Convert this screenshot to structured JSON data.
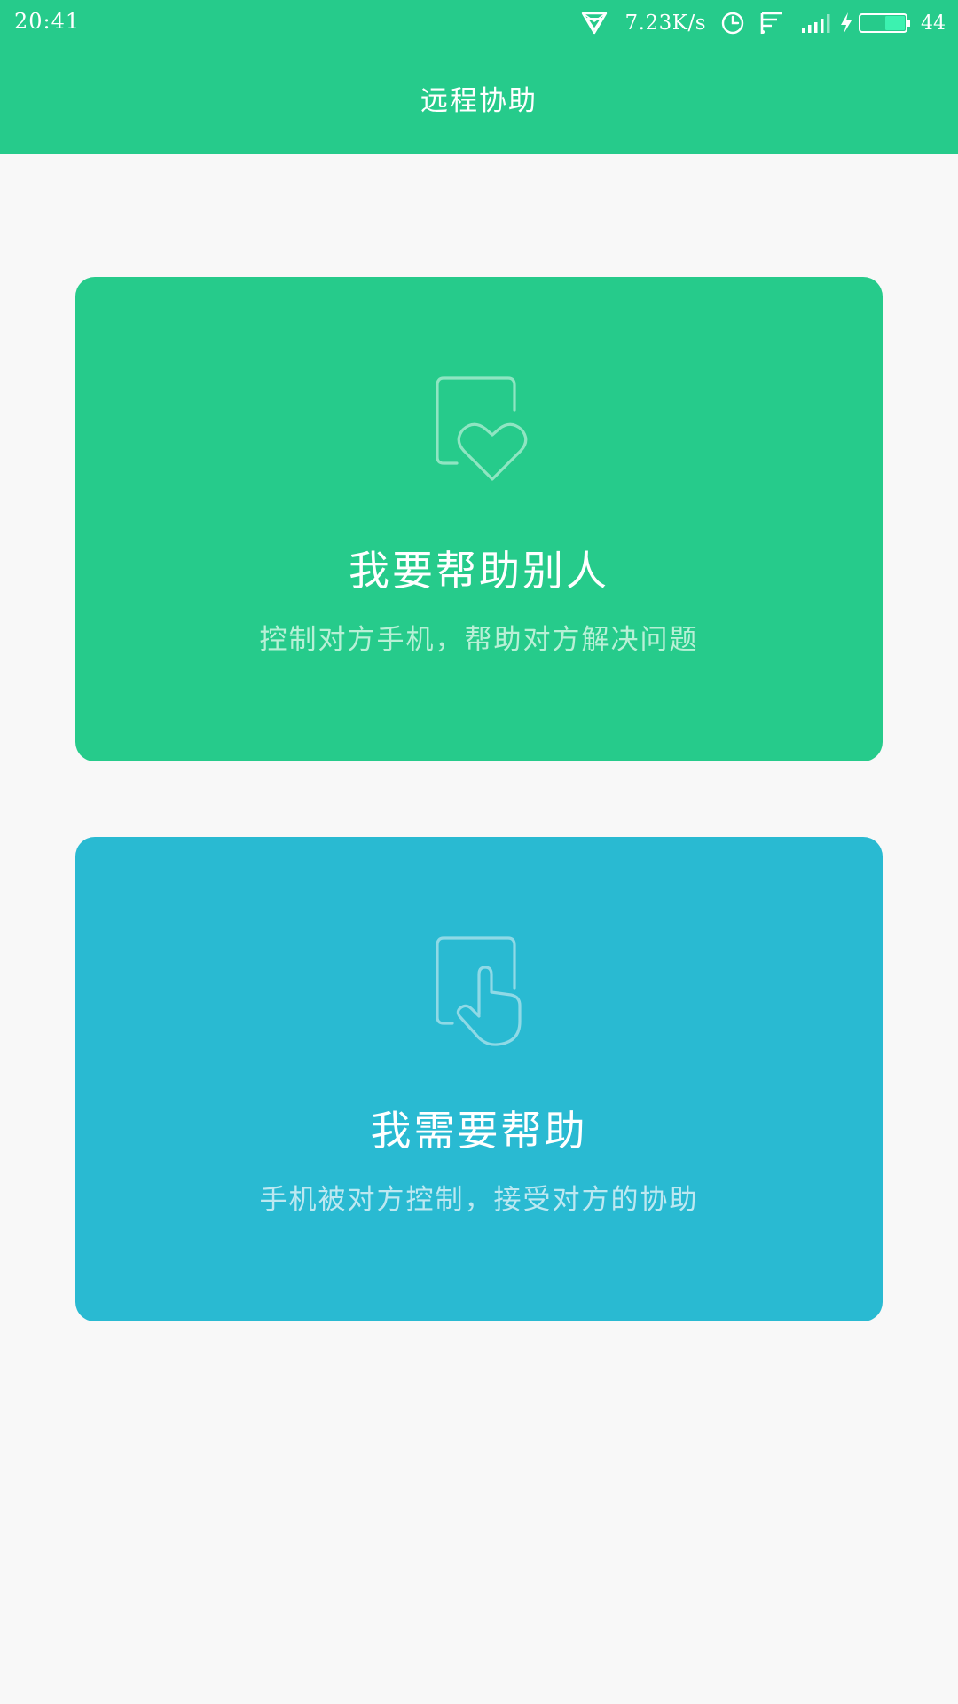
{
  "status_bar": {
    "time": "20:41",
    "network_speed": "7.23K/s",
    "battery_percent": "44",
    "battery_level": 0.44,
    "icons": [
      "vpn-triangle-icon",
      "alarm-clock-icon",
      "cast-icon",
      "signal-icon",
      "charging-icon",
      "battery-icon"
    ]
  },
  "header": {
    "title": "远程协助"
  },
  "cards": [
    {
      "title": "我要帮助别人",
      "subtitle": "控制对方手机，帮助对方解决问题",
      "icon": "phone-heart-icon",
      "color": "#26cb8b"
    },
    {
      "title": "我需要帮助",
      "subtitle": "手机被对方控制，接受对方的协助",
      "icon": "phone-touch-icon",
      "color": "#29bad2"
    }
  ],
  "colors": {
    "primary_green": "#26cb8b",
    "primary_blue": "#29bad2",
    "background": "#f8f8f8"
  }
}
